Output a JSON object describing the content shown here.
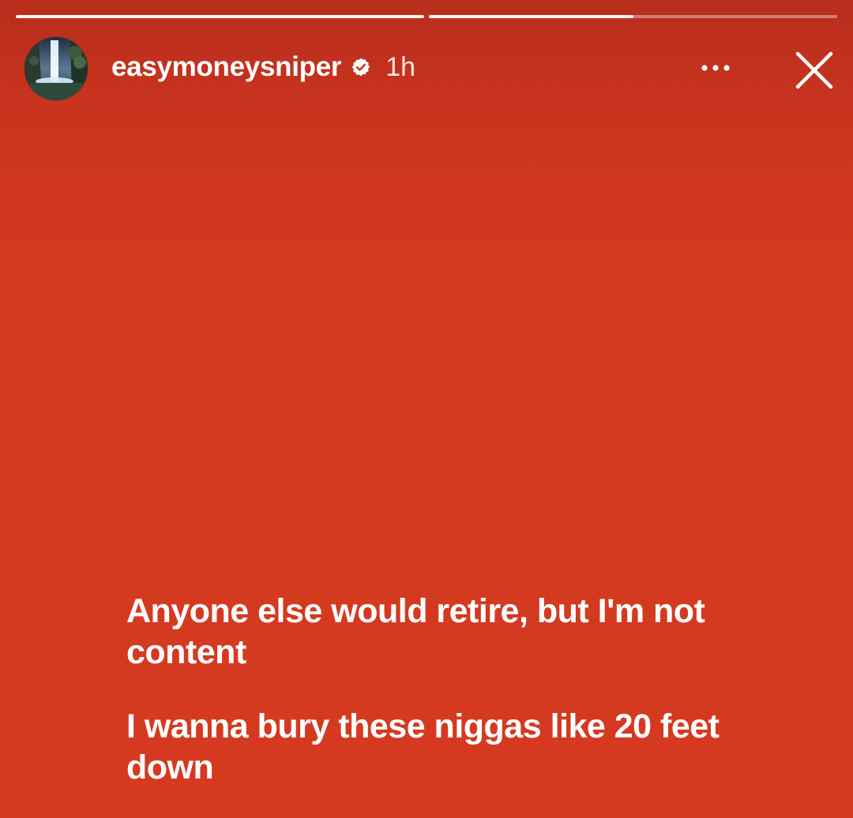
{
  "story": {
    "progress": [
      1.0,
      0.5
    ],
    "username": "easymoneysniper",
    "verified_icon": "verified-badge-icon",
    "time": "1h",
    "more_icon": "more-options-icon",
    "close_icon": "close-icon",
    "colors": {
      "background": "#d33a22",
      "text": "#ffffff"
    }
  },
  "caption": {
    "line1": "Anyone else would retire, but I'm not content",
    "line2": "I wanna bury these niggas like 20 feet down"
  }
}
